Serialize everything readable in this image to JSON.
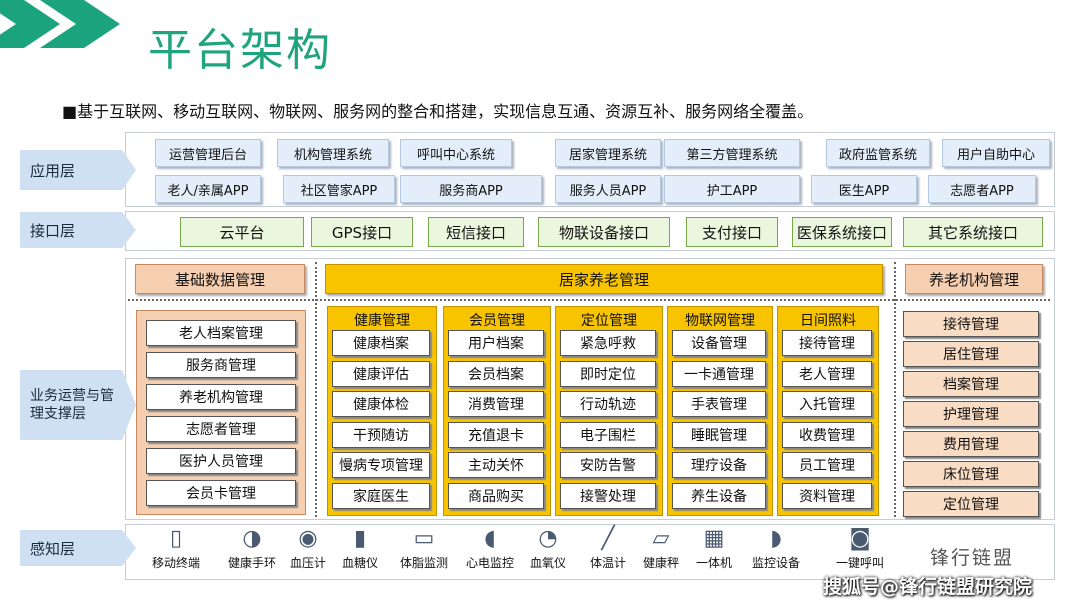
{
  "title": "平台架构",
  "subtitle": "■基于互联网、移动互联网、物联网、服务网的整合和搭建，实现信息互通、资源互补、服务网络全覆盖。",
  "layers": {
    "application": "应用层",
    "interface": "接口层",
    "business": "业务运营与管理支撑层",
    "perception": "感知层"
  },
  "apps_row1": [
    "运营管理后台",
    "机构管理系统",
    "呼叫中心系统",
    "居家管理系统",
    "第三方管理系统",
    "政府监管系统",
    "用户自助中心"
  ],
  "apps_row2": [
    "老人/亲属APP",
    "社区管家APP",
    "服务商APP",
    "服务人员APP",
    "护工APP",
    "医生APP",
    "志愿者APP"
  ],
  "interfaces": [
    "云平台",
    "GPS接口",
    "短信接口",
    "物联设备接口",
    "支付接口",
    "医保系统接口",
    "其它系统接口"
  ],
  "basic": {
    "header": "基础数据管理",
    "items": [
      "老人档案管理",
      "服务商管理",
      "养老机构管理",
      "志愿者管理",
      "医护人员管理",
      "会员卡管理"
    ]
  },
  "home": {
    "header": "居家养老管理",
    "columns": [
      {
        "title": "健康管理",
        "items": [
          "健康档案",
          "健康评估",
          "健康体检",
          "干预随访",
          "慢病专项管理",
          "家庭医生"
        ]
      },
      {
        "title": "会员管理",
        "items": [
          "用户档案",
          "会员档案",
          "消费管理",
          "充值退卡",
          "主动关怀",
          "商品购买"
        ]
      },
      {
        "title": "定位管理",
        "items": [
          "紧急呼救",
          "即时定位",
          "行动轨迹",
          "电子围栏",
          "安防告警",
          "接警处理"
        ]
      },
      {
        "title": "物联网管理",
        "items": [
          "设备管理",
          "一卡通管理",
          "手表管理",
          "睡眠管理",
          "理疗设备",
          "养生设备"
        ]
      },
      {
        "title": "日间照料",
        "items": [
          "接待管理",
          "老人管理",
          "入托管理",
          "收费管理",
          "员工管理",
          "资料管理"
        ]
      }
    ]
  },
  "institution": {
    "header": "养老机构管理",
    "items": [
      "接待管理",
      "居住管理",
      "档案管理",
      "护理管理",
      "费用管理",
      "床位管理",
      "定位管理"
    ]
  },
  "devices": [
    "移动终端",
    "健康手环",
    "血压计",
    "血糖仪",
    "体脂监测",
    "心电监控",
    "血氧仪",
    "体温计",
    "健康秤",
    "一体机",
    "监控设备",
    "一键呼叫"
  ],
  "device_icons": [
    "phone-icon",
    "wristband-icon",
    "blood-pressure-monitor-icon",
    "glucose-meter-icon",
    "body-fat-scale-icon",
    "ecg-monitor-icon",
    "oximeter-icon",
    "thermometer-icon",
    "health-scale-icon",
    "kiosk-icon",
    "security-camera-icon",
    "call-button-icon"
  ],
  "watermark_logo": "锋行链盟",
  "watermark_text": "搜狐号@锋行链盟研究院"
}
